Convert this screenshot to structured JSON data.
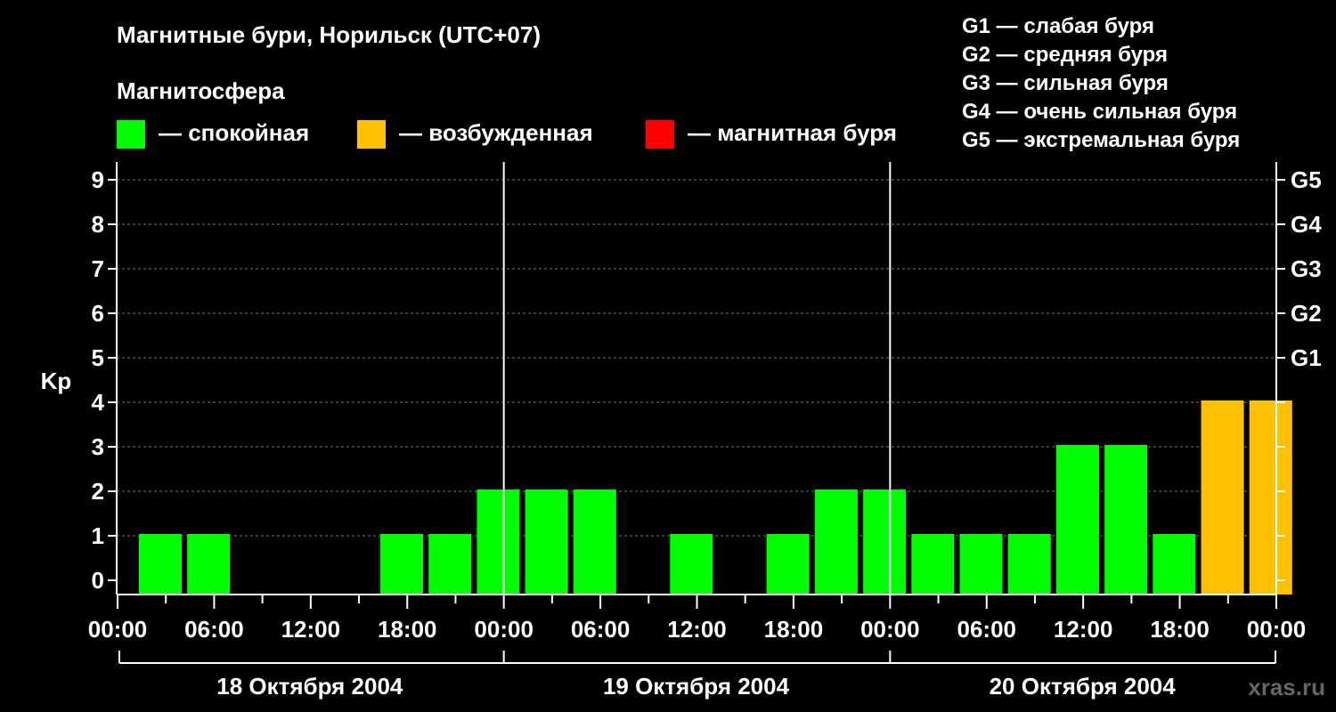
{
  "header": {
    "title": "Магнитные бури, Норильск (UTC+07)",
    "subtitle": "Магнитосфера"
  },
  "legend": {
    "items": [
      {
        "label": "— спокойная",
        "color": "#00ff00"
      },
      {
        "label": "— возбужденная",
        "color": "#ffc000"
      },
      {
        "label": "— магнитная буря",
        "color": "#ff0000"
      }
    ]
  },
  "g_legend": [
    "G1 — слабая буря",
    "G2 — средняя буря",
    "G3 — сильная буря",
    "G4 — очень сильная буря",
    "G5 — экстремальная буря"
  ],
  "watermark": "xras.ru",
  "chart_data": {
    "type": "bar",
    "ylabel": "Kp",
    "ylim": [
      0,
      9
    ],
    "yticks": [
      "0",
      "1",
      "2",
      "3",
      "4",
      "5",
      "6",
      "7",
      "8",
      "9"
    ],
    "right_ticks": [
      {
        "value": 5,
        "label": "G1"
      },
      {
        "value": 6,
        "label": "G2"
      },
      {
        "value": 7,
        "label": "G3"
      },
      {
        "value": 8,
        "label": "G4"
      },
      {
        "value": 9,
        "label": "G5"
      }
    ],
    "grid": true,
    "xtick_labels": [
      "00:00",
      "06:00",
      "12:00",
      "18:00",
      "00:00",
      "06:00",
      "12:00",
      "18:00",
      "00:00",
      "06:00",
      "12:00",
      "18:00",
      "00:00"
    ],
    "days": [
      "18 Октября 2004",
      "19 Октября 2004",
      "20 Октября 2004"
    ],
    "interval_hours": 3,
    "values": [
      1,
      1,
      0,
      0,
      0,
      1,
      1,
      2,
      2,
      2,
      0,
      1,
      0,
      1,
      2,
      2,
      1,
      1,
      1,
      3,
      3,
      1,
      4,
      4
    ],
    "colors": [
      "#00ff00",
      "#00ff00",
      "#00ff00",
      "#00ff00",
      "#00ff00",
      "#00ff00",
      "#00ff00",
      "#00ff00",
      "#00ff00",
      "#00ff00",
      "#00ff00",
      "#00ff00",
      "#00ff00",
      "#00ff00",
      "#00ff00",
      "#00ff00",
      "#00ff00",
      "#00ff00",
      "#00ff00",
      "#00ff00",
      "#00ff00",
      "#00ff00",
      "#ffc000",
      "#ffc000"
    ]
  }
}
